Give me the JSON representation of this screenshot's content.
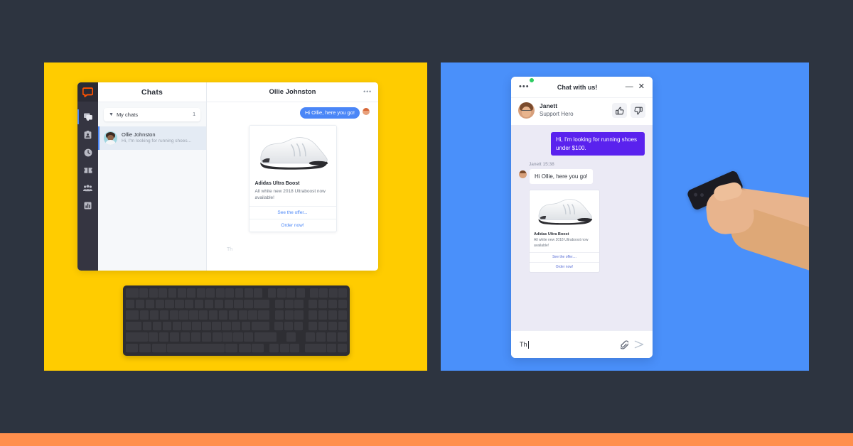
{
  "colors": {
    "background": "#2d3440",
    "left_panel": "#ffcc00",
    "right_panel": "#4a90fa",
    "bottom_stripe": "#ff8f4d",
    "accent_blue": "#4a86f7",
    "accent_purple": "#5a22ee",
    "logo_orange": "#ff5100",
    "online_green": "#2ecc62"
  },
  "desktop_app": {
    "sidebar": {
      "logo_name": "livechat-logo-icon",
      "items": [
        {
          "name": "chats-icon",
          "label": "Chats",
          "active": true
        },
        {
          "name": "contact-card-icon",
          "label": "Archives",
          "active": false
        },
        {
          "name": "clock-icon",
          "label": "History",
          "active": false
        },
        {
          "name": "tickets-icon",
          "label": "Tickets",
          "active": false
        },
        {
          "name": "team-icon",
          "label": "Team",
          "active": false
        },
        {
          "name": "reports-icon",
          "label": "Reports",
          "active": false
        }
      ]
    },
    "chats_column": {
      "header": "Chats",
      "group": {
        "label": "My chats",
        "count": "1"
      },
      "items": [
        {
          "name": "Ollie Johnston",
          "snippet": "Hi, I'm looking for running shoes..."
        }
      ]
    },
    "conversation": {
      "title": "Ollie Johnston",
      "more_icon": "•••",
      "messages": [
        {
          "from": "agent",
          "text": "Hi Ollie, here you go!"
        }
      ],
      "product_card": {
        "title": "Adidas Ultra Boost",
        "description": "All white new 2018 Ultraboost now available!",
        "buttons": [
          "See the offer...",
          "Order now!"
        ],
        "image_alt": "white-running-shoe"
      },
      "typing_draft": "Th"
    }
  },
  "keyboard": {
    "name": "magic-keyboard-with-numeric-keypad"
  },
  "mobile_widget": {
    "header": {
      "menu_icon": "•••",
      "title": "Chat with us!",
      "minimize_icon": "—",
      "close_icon": "✕"
    },
    "agent": {
      "name": "Janett",
      "role": "Support Hero",
      "status": "online",
      "thumbs_up_icon": "thumbs-up",
      "thumbs_down_icon": "thumbs-down"
    },
    "messages": [
      {
        "from": "visitor",
        "text": "Hi, I'm looking for running shoes under $100."
      },
      {
        "from": "agent",
        "stamp": "Janett 15:38",
        "text": "Hi Ollie, here you go!"
      }
    ],
    "product_card": {
      "title": "Adidas Ultra Boost",
      "description": "All white new 2018 Ultraboost now available!",
      "buttons": [
        "See the offer....",
        "Order now!"
      ]
    },
    "composer": {
      "value": "Th",
      "attach_icon": "paperclip",
      "send_icon": "send-arrow"
    }
  },
  "photo": {
    "hand_with_phone": "hand-holding-smartphone"
  }
}
